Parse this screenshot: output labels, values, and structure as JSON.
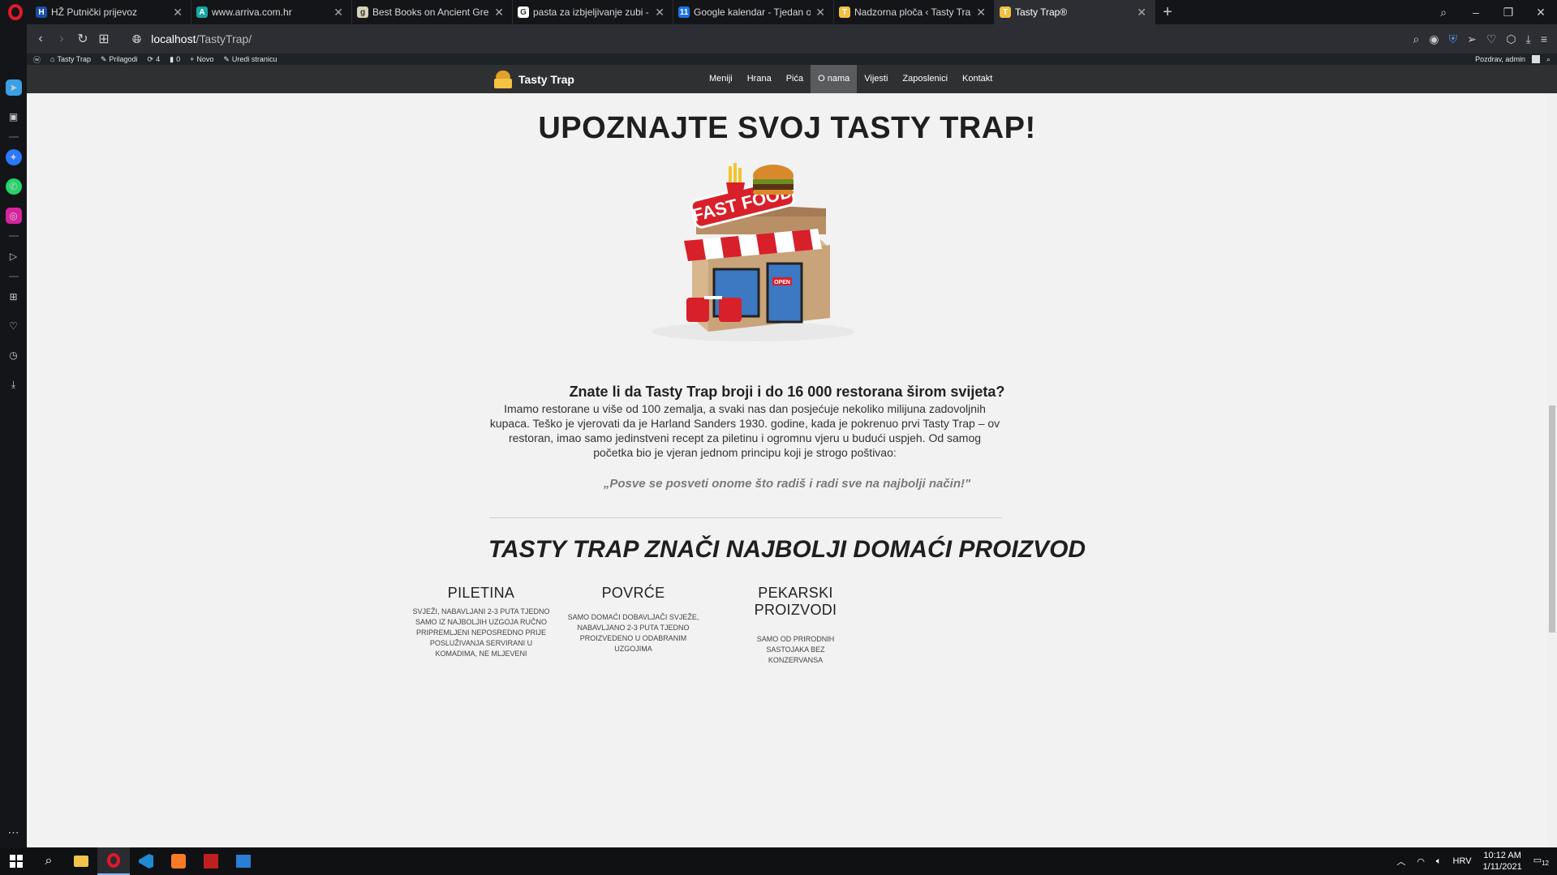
{
  "browser": {
    "tabs": [
      {
        "title": "HŽ Putnički prijevoz",
        "fav_color": "#1a4fa3",
        "fav_glyph": "H"
      },
      {
        "title": "www.arriva.com.hr",
        "fav_color": "#19a5a0",
        "fav_glyph": "A"
      },
      {
        "title": "Best Books on Ancient Gre",
        "fav_color": "#d8d0b8",
        "fav_glyph": "g"
      },
      {
        "title": "pasta za izbjeljivanje zubi -",
        "fav_color": "#ffffff",
        "fav_glyph": "G"
      },
      {
        "title": "Google kalendar - Tjedan o",
        "fav_color": "#1a73e8",
        "fav_glyph": "11"
      },
      {
        "title": "Nadzorna ploča ‹ Tasty Trap",
        "fav_color": "#f0c040",
        "fav_glyph": "T"
      },
      {
        "title": "Tasty Trap®",
        "fav_color": "#f0c040",
        "fav_glyph": "T"
      }
    ],
    "url_host": "localhost",
    "url_path": "/TastyTrap/"
  },
  "adminbar": {
    "items": [
      "Tasty Trap",
      "Prilagodi",
      "4",
      "0",
      "Novo",
      "Uredi stranicu"
    ],
    "greeting": "Pozdrav, admin"
  },
  "site": {
    "brand": "Tasty Trap",
    "menu": [
      "Meniji",
      "Hrana",
      "Pića",
      "O nama",
      "Vijesti",
      "Zaposlenici",
      "Kontakt"
    ]
  },
  "page": {
    "hero_title": "UPOZNAJTE SVOJ TASTY TRAP!",
    "sign_text": "FAST FOOD",
    "open_text": "OPEN",
    "subtitle": "Znate li da Tasty Trap broji i do 16 000 restorana širom svijeta?",
    "paragraph": "Imamo restorane u više od 100 zemalja, a svaki nas dan posjećuje nekoliko milijuna zadovoljnih kupaca. Teško je vjerovati da je Harland Sanders 1930. godine, kada je pokrenuo prvi Tasty Trap – ov restoran, imao samo jedinstveni recept za piletinu i ogromnu vjeru u budući uspjeh. Od samog početka bio je vjeran jednom principu koji je strogo poštivao:",
    "quote": "„Posve se posveti onome što radiš i radi sve na najbolji način!\"",
    "section_title": "TASTY TRAP ZNAČI NAJBOLJI DOMAĆI PROIZVOD",
    "features": [
      {
        "title": "PILETINA",
        "text": "SVJEŽI, NABAVLJANI 2-3 PUTA TJEDNO SAMO IZ NAJBOLJIH UZGOJA RUČNO PRIPREMLJENI NEPOSREDNO PRIJE POSLUŽIVANJA SERVIRANI U KOMADIMA, NE MLJEVENI"
      },
      {
        "title": "POVRĆE",
        "text": "SAMO DOMAĆI DOBAVLJAČI SVJEŽE, NABAVLJANO 2-3 PUTA TJEDNO PROIZVEDENO U ODABRANIM UZGOJIMA"
      },
      {
        "title": "PEKARSKI PROIZVODI",
        "text": "SAMO OD PRIRODNIH SASTOJAKA BEZ KONZERVANSA"
      }
    ]
  },
  "taskbar": {
    "language": "HRV",
    "time": "10:12 AM",
    "date": "1/11/2021",
    "notifications": "12"
  }
}
